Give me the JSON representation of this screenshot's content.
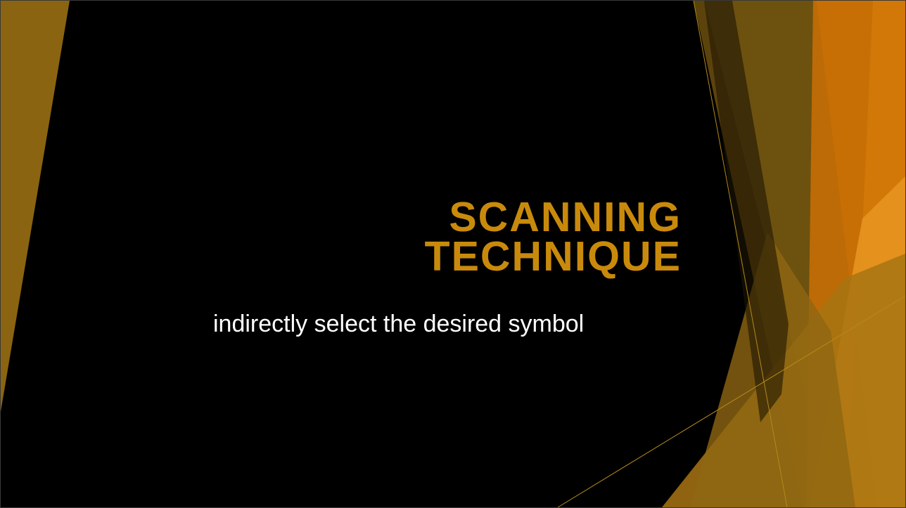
{
  "slide": {
    "title_line1": "SCANNING",
    "title_line2": "TECHNIQUE",
    "subtitle": "indirectly select the desired symbol"
  },
  "theme": {
    "background": "#000000",
    "title_color": "#C98A0C",
    "subtitle_color": "#FFFFFF",
    "accent_gold": "#8A6410",
    "accent_orange": "#E07A00"
  }
}
